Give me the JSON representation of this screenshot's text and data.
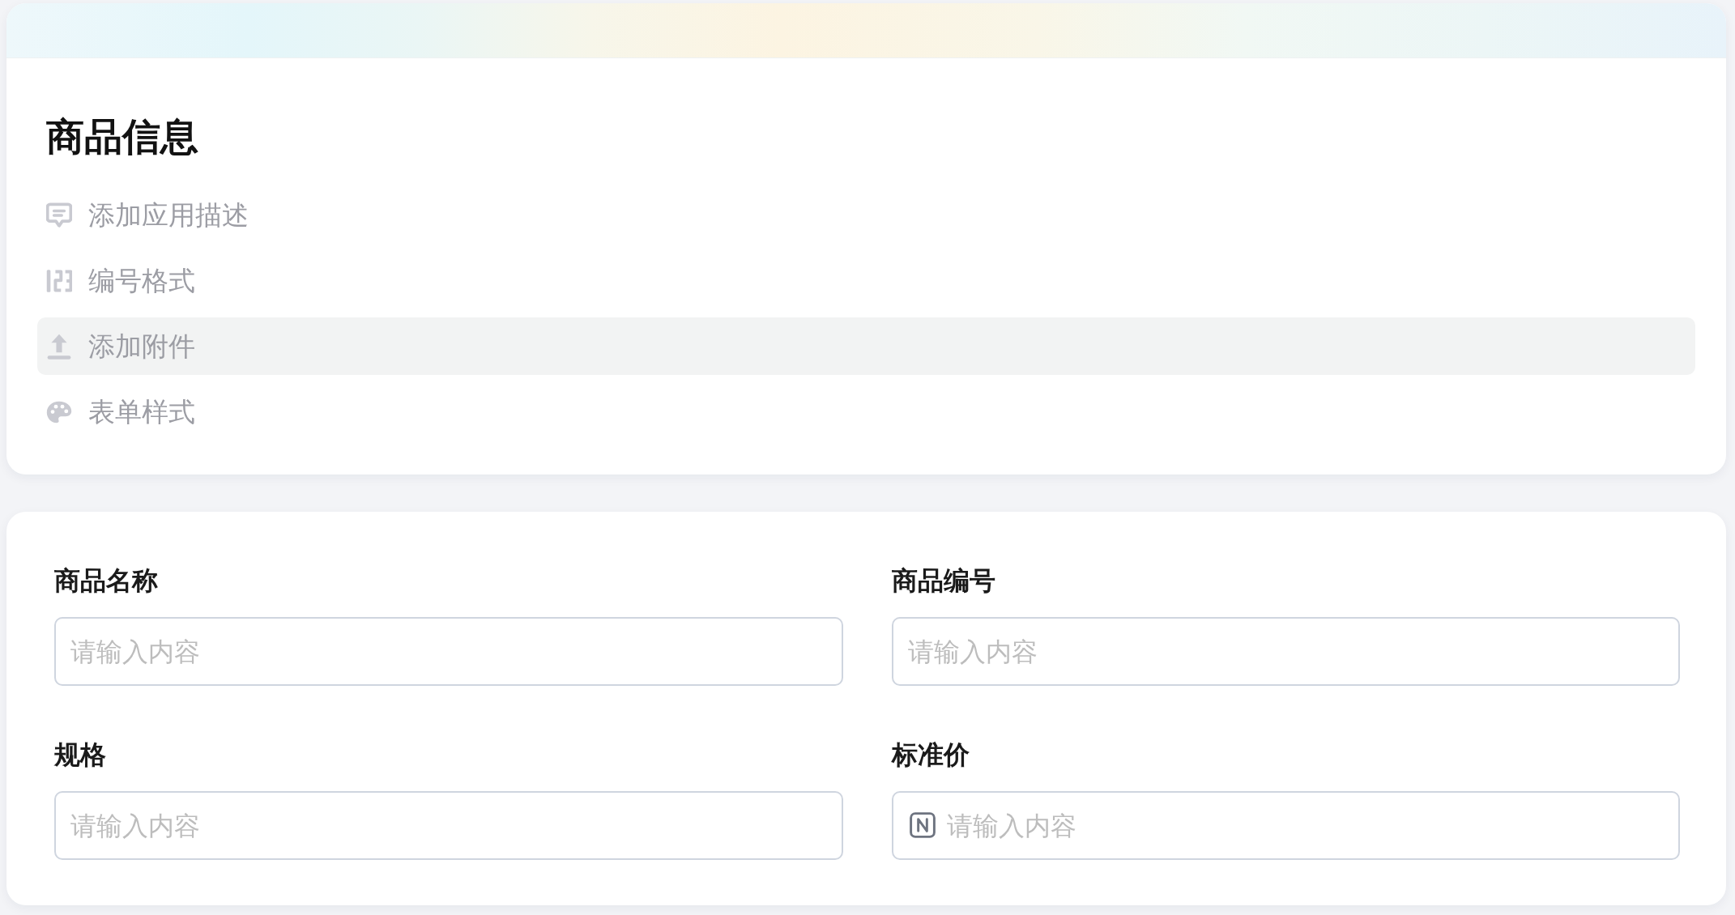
{
  "info_panel": {
    "title": "商品信息",
    "menu": [
      {
        "label": "添加应用描述",
        "kind": "comment",
        "selected": false
      },
      {
        "label": "编号格式",
        "kind": "numbering",
        "selected": false
      },
      {
        "label": "添加附件",
        "kind": "upload",
        "selected": true
      },
      {
        "label": "表单样式",
        "kind": "palette",
        "selected": false
      }
    ]
  },
  "form": {
    "fields": [
      {
        "label": "商品名称",
        "placeholder": "请输入内容",
        "kind": "text"
      },
      {
        "label": "商品编号",
        "placeholder": "请输入内容",
        "kind": "text"
      },
      {
        "label": "规格",
        "placeholder": "请输入内容",
        "kind": "text"
      },
      {
        "label": "标准价",
        "placeholder": "请输入内容",
        "kind": "number"
      }
    ]
  }
}
